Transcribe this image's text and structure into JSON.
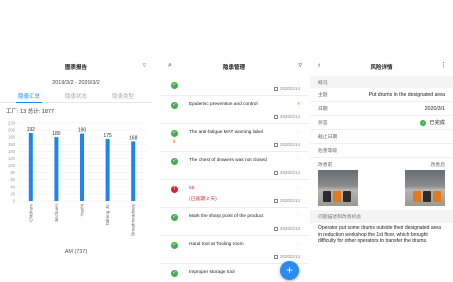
{
  "panel1": {
    "title": "图表报告",
    "date_range": "2019/3/2 - 2020/3/2",
    "tabs": [
      "隐患汇总",
      "隐患状态",
      "隐患类型"
    ],
    "stats": "工厂: 13  总计: 1877",
    "footer": "AM (737)",
    "chart_data": {
      "type": "bar",
      "categories": [
        "Chickum",
        "Jinchuen",
        "Yasthi",
        "Takeng JV",
        "Broadmeadows"
      ],
      "values": [
        192,
        180,
        190,
        175,
        168
      ],
      "yticks": [
        0,
        20,
        40,
        60,
        80,
        100,
        120,
        140,
        160,
        180,
        200,
        220
      ],
      "ylim": [
        0,
        220
      ],
      "bar_color": "#1c86ee"
    }
  },
  "panel2": {
    "title": "隐患管理",
    "items": [
      {
        "title": "",
        "date": "2020/2/14",
        "icon": "check-icon",
        "star": false
      },
      {
        "title": "Epidemic prevention and control",
        "date": "2020/2/14",
        "icon": "check-icon",
        "star": true
      },
      {
        "title": "The anti-fatigue MAT warning label",
        "date": "2020/2/14",
        "icon": "check-icon",
        "star": false
      },
      {
        "title": "The chest of drawers was not closed",
        "date": "2020/2/14",
        "icon": "check-icon",
        "star": false
      },
      {
        "title": "55",
        "subtitle": "(已逾期 2 天)",
        "date": "2020/2/13",
        "icon": "alert-icon",
        "star": false
      },
      {
        "title": "Mark the sharp point of the product",
        "date": "2020/2/13",
        "icon": "check-icon",
        "star": false
      },
      {
        "title": "Hand tool at Tooling room",
        "date": "2020/2/13",
        "icon": "check-icon",
        "star": false
      },
      {
        "title": "Improper storage tool",
        "date": "",
        "icon": "check-icon",
        "star": false
      }
    ],
    "fab": "+"
  },
  "panel3": {
    "title": "风险详情",
    "section": "概况",
    "rows": [
      {
        "key": "主题",
        "value": "Put drums in the designated area"
      },
      {
        "key": "日期",
        "value": "2020/3/1"
      },
      {
        "key": "状态",
        "value": "已完成"
      },
      {
        "key": "截止日期",
        "value": ""
      },
      {
        "key": "危害等级",
        "value": ""
      }
    ],
    "img_before": "改善前",
    "img_after": "改善后",
    "desc_title": "问题描述和改善机会",
    "desc_text": "Operator put some drums outside their designated area in reduction workshop the 1st floor, which brought difficulty for other operators to transfer the drums."
  }
}
